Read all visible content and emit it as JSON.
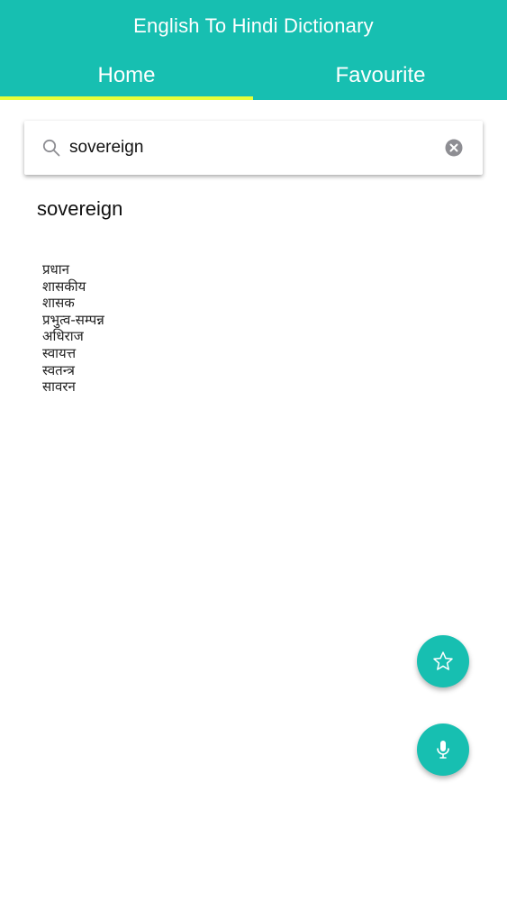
{
  "header": {
    "title": "English To Hindi Dictionary",
    "accent_color": "#17bfb1",
    "indicator_color": "#e6ff3a"
  },
  "tabs": [
    {
      "label": "Home",
      "active": true
    },
    {
      "label": "Favourite",
      "active": false
    }
  ],
  "search": {
    "value": "sovereign",
    "placeholder": "",
    "icon": "search-icon",
    "clear_icon": "clear-icon"
  },
  "result": {
    "word": "sovereign",
    "meanings": [
      "प्रधान",
      "शासकीय",
      "शासक",
      "प्रभुत्व-सम्पन्न",
      "अधिराज",
      "स्वायत्त",
      "स्वतन्त्र",
      "सावरन"
    ]
  },
  "actions": {
    "favourite_icon": "star-icon",
    "voice_icon": "microphone-icon"
  }
}
